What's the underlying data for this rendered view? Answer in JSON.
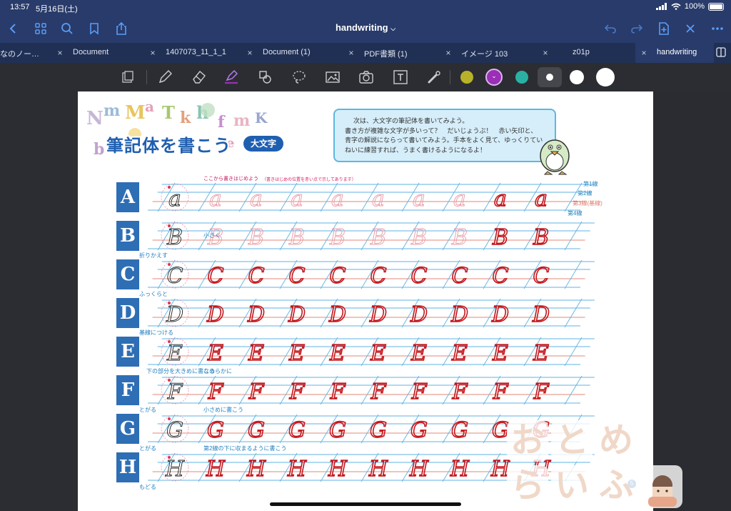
{
  "status": {
    "time": "13:57",
    "date": "5月16日(土)",
    "battery": "100%"
  },
  "nav": {
    "title": "handwriting"
  },
  "tabs": [
    {
      "label": "なのノー…",
      "active": false
    },
    {
      "label": "Document",
      "active": false
    },
    {
      "label": "1407073_11_1_1",
      "active": false
    },
    {
      "label": "Document (1)",
      "active": false
    },
    {
      "label": "PDF書類 (1)",
      "active": false
    },
    {
      "label": "イメージ 103",
      "active": false
    },
    {
      "label": "z01p",
      "active": false
    },
    {
      "label": "handwriting",
      "active": true
    }
  ],
  "colors": {
    "olive": "#b8b22a",
    "purple": "#9b2fb5",
    "teal": "#2ab1a4",
    "white": "#ffffff",
    "ink_red": "#c4161c",
    "guide_blue": "#5fb3e3",
    "base_red": "#e08a7a",
    "brand_blue": "#2e6eb5"
  },
  "doc": {
    "title": "筆記体を書こう",
    "badge": "大文字",
    "bubble_lines": [
      "次は、大文字の筆記体を書いてみよう。",
      "書き方が複雑な文字が多いって？　だいじょうぶ！　赤い矢印と、",
      "青字の解説にならって書いてみよう。手本をよく見て、ゆっくりてい",
      "ねいに練習すれば、うまく書けるようになるよ！"
    ],
    "start_note": "ここから書きはじめよう",
    "start_note2": "（書きはじめの位置を赤い点で示してあります）",
    "guide_labels": [
      "第1線",
      "第2線",
      "第3線(基線)",
      "第4線"
    ],
    "rows": [
      {
        "letter": "A",
        "glyph": "a",
        "hint_top": "",
        "hint_bottom": "",
        "hint_right": ""
      },
      {
        "letter": "B",
        "glyph": "B",
        "hint_top": "",
        "hint_bottom": "折りかえす",
        "hint_right": "小さく"
      },
      {
        "letter": "C",
        "glyph": "C",
        "hint_top": "",
        "hint_bottom": "ふっくらと",
        "hint_right": ""
      },
      {
        "letter": "D",
        "glyph": "D",
        "hint_top": "",
        "hint_bottom": "基線につける",
        "hint_right": ""
      },
      {
        "letter": "E",
        "glyph": "E",
        "hint_top": "",
        "hint_bottom": "下の部分を大きめに書こう",
        "hint_right": ""
      },
      {
        "letter": "F",
        "glyph": "F",
        "hint_top": "なめらかに",
        "hint_bottom": "とがる",
        "hint_right": ""
      },
      {
        "letter": "G",
        "glyph": "G",
        "hint_top": "小さめに書こう",
        "hint_bottom": "とがる",
        "hint_right": ""
      },
      {
        "letter": "H",
        "glyph": "H",
        "hint_top": "第2線の下に収まるように書こう",
        "hint_bottom": "もどる",
        "hint_right": ""
      }
    ],
    "page_number": "5",
    "watermark": [
      "お",
      "と",
      "め",
      "ら",
      "い",
      "ふ"
    ]
  },
  "icons": {
    "nav_left": [
      "back-icon",
      "grid-icon",
      "search-icon",
      "bookmark-icon",
      "share-icon"
    ],
    "nav_right": [
      "undo-icon",
      "redo-icon",
      "add-page-icon",
      "close-icon",
      "more-icon"
    ],
    "tools": [
      "pages-icon",
      "pen-icon",
      "eraser-icon",
      "highlighter-icon",
      "shapes-icon",
      "lasso-icon",
      "image-icon",
      "camera-icon",
      "textbox-icon",
      "laser-icon"
    ]
  }
}
